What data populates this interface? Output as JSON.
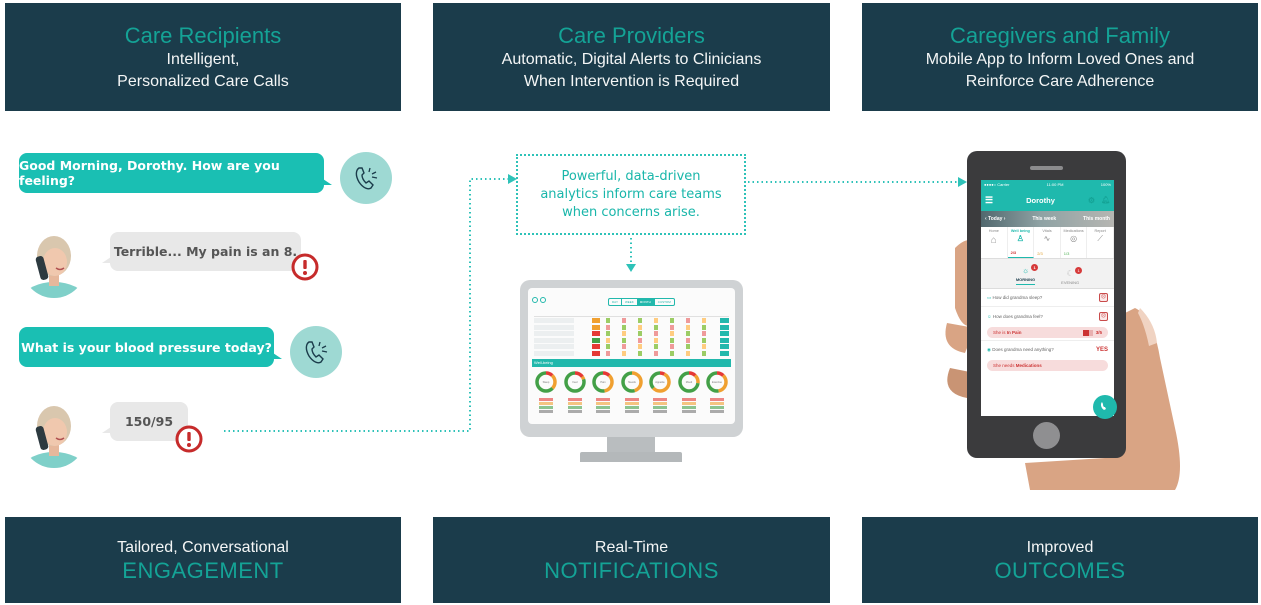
{
  "top_panels": [
    {
      "title": "Care Recipients",
      "subtitle_lines": [
        "Intelligent,",
        "Personalized Care Calls"
      ]
    },
    {
      "title": "Care Providers",
      "subtitle_lines": [
        "Automatic, Digital Alerts to Clinicians",
        "When Intervention is Required"
      ]
    },
    {
      "title": "Caregivers and Family",
      "subtitle_lines": [
        "Mobile App to Inform Loved Ones and",
        "Reinforce Care Adherence"
      ]
    }
  ],
  "bottom_panels": [
    {
      "subtitle": "Tailored, Conversational",
      "title": "ENGAGEMENT"
    },
    {
      "subtitle": "Real-Time",
      "title": "NOTIFICATIONS"
    },
    {
      "subtitle": "Improved",
      "title": "OUTCOMES"
    }
  ],
  "conversation": [
    {
      "speaker": "system",
      "text": "Good Morning, Dorothy. How are you feeling?",
      "icon": "phone-call-icon"
    },
    {
      "speaker": "patient",
      "text": "Terrible... My pain is an 8.",
      "alert": true
    },
    {
      "speaker": "system",
      "text": "What is your blood pressure today?",
      "icon": "phone-call-icon"
    },
    {
      "speaker": "patient",
      "text": "150/95",
      "alert": true
    }
  ],
  "analytics_note": {
    "lines": [
      "Powerful, data-driven",
      "analytics inform care teams",
      "when concerns arise."
    ]
  },
  "dashboard": {
    "section_title": "Well-being",
    "range_buttons": [
      "DAY",
      "WEEK",
      "MONTH",
      "CUSTOM"
    ],
    "active_range": "MONTH",
    "donuts": [
      "Sleep",
      "Feel",
      "Pain",
      "Needs",
      "Appetite",
      "Mood",
      "Exercise"
    ]
  },
  "mobile_app": {
    "status_bar": {
      "carrier": "●●●●○ Carrier",
      "time": "11:00 PM",
      "battery": "100%"
    },
    "patient_name": "Dorothy",
    "date_tabs": [
      "Today",
      "This week",
      "This month"
    ],
    "category_tabs": [
      {
        "label": "Home",
        "count": ""
      },
      {
        "label": "Well being",
        "count": "2/3",
        "active": true
      },
      {
        "label": "Vitals",
        "count": "2/3"
      },
      {
        "label": "Medications",
        "count": "1/3"
      },
      {
        "label": "Report",
        "count": ""
      }
    ],
    "time_tabs": [
      {
        "label": "MORNING",
        "badge": "1",
        "active": true
      },
      {
        "label": "EVENING",
        "badge": "1"
      }
    ],
    "questions": [
      {
        "text": "How did grandma sleep?",
        "face": "☹"
      },
      {
        "text": "How does grandma feel?",
        "face": "☹"
      }
    ],
    "pain_pill": {
      "prefix": "She is ",
      "value": "In Pain",
      "score": "3/5"
    },
    "needs_question": {
      "text": "Does grandma need anything?",
      "answer": "YES"
    },
    "needs_pill": {
      "prefix": "She needs ",
      "value": "Medications"
    }
  },
  "colors": {
    "panel_bg": "#1b3c4b",
    "accent_teal": "#14a396",
    "bubble_teal": "#1abfb3",
    "alert_red": "#c62b2b"
  }
}
